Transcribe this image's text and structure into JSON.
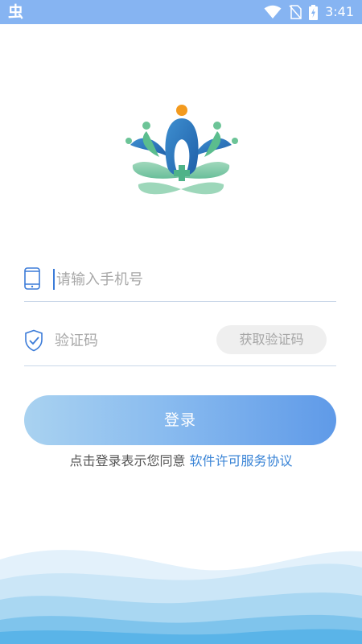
{
  "status_bar": {
    "time": "3:41",
    "left_icon": "app-notification-icon",
    "right_icons": [
      "wifi-icon",
      "no-sim-icon",
      "battery-charging-icon"
    ],
    "background": "#86b4f2"
  },
  "logo": {
    "icon": "lotus-medical-logo"
  },
  "phone_field": {
    "placeholder": "请输入手机号",
    "icon": "phone-icon"
  },
  "code_field": {
    "placeholder": "验证码",
    "icon": "shield-check-icon"
  },
  "get_code_button": {
    "label": "获取验证码"
  },
  "login_button": {
    "label": "登录"
  },
  "agreement": {
    "prefix": "点击登录表示您同意",
    "link_label": "软件许可服务协议"
  },
  "colors": {
    "accent": "#3a84d6",
    "button_start": "#a9d2f0",
    "button_end": "#5f9ae8"
  }
}
